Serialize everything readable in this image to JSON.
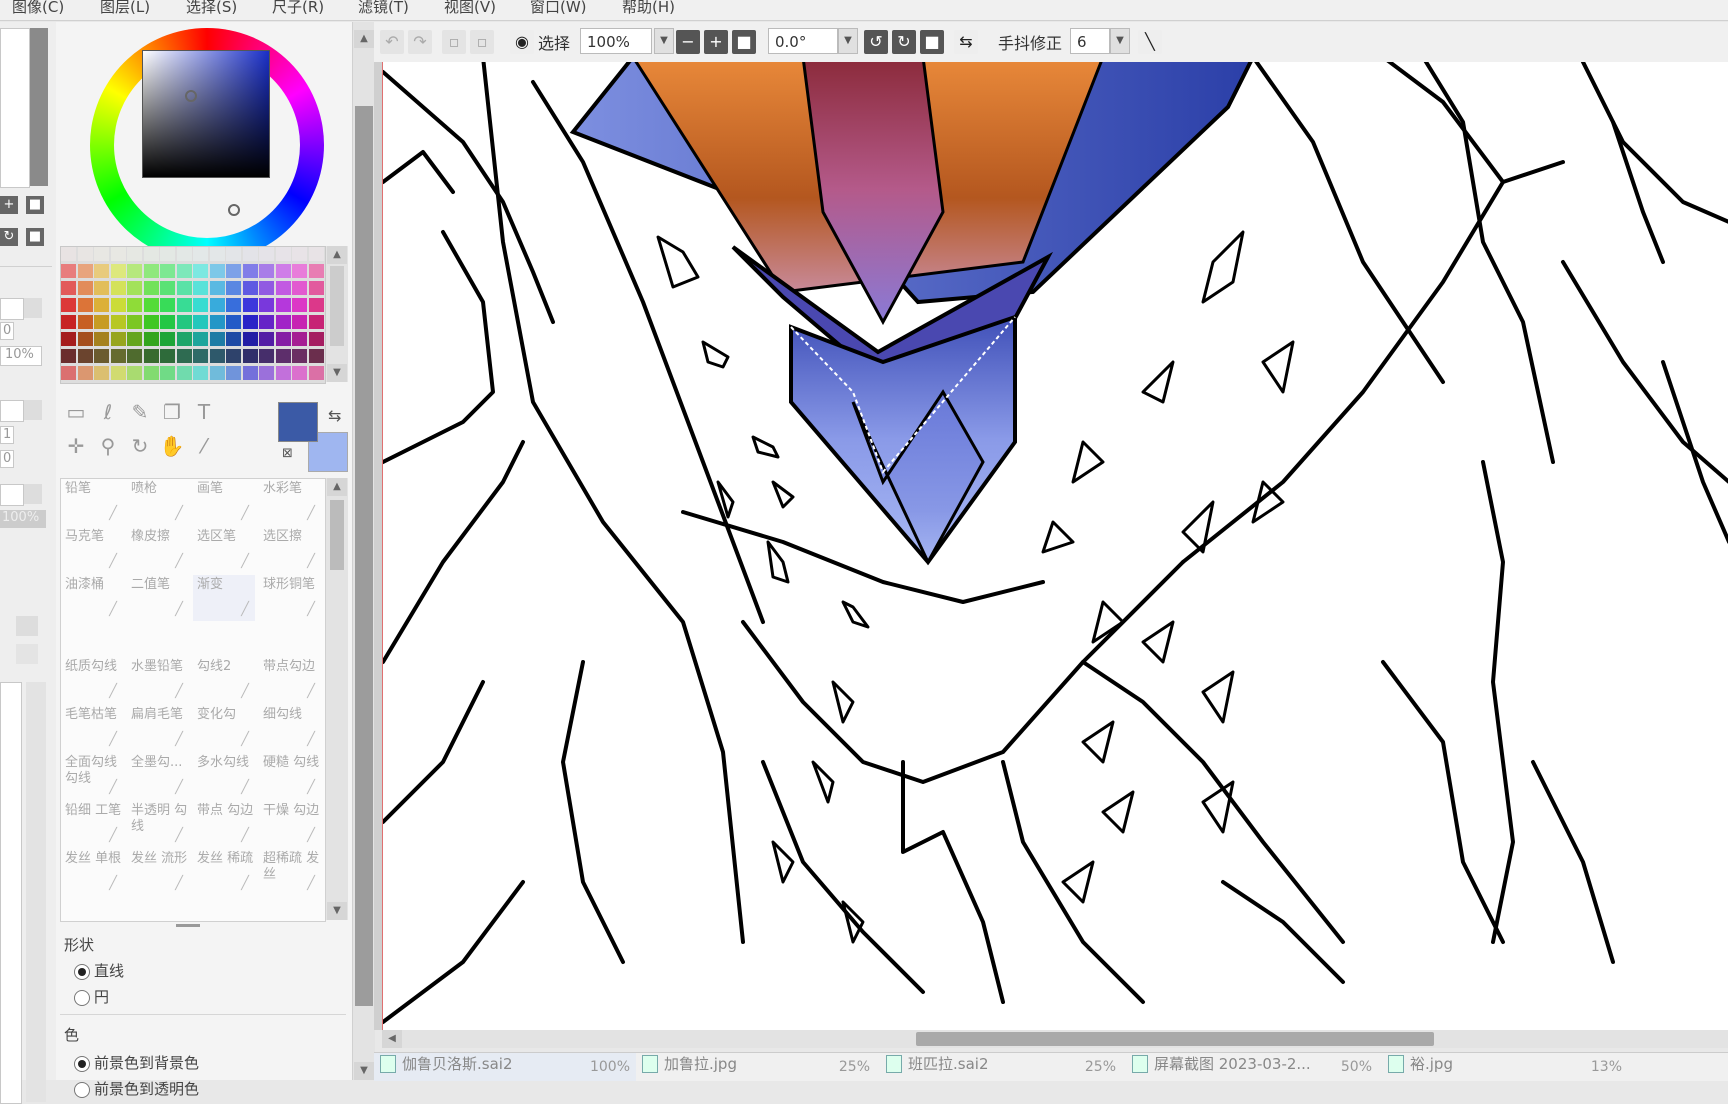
{
  "menu": [
    "图像(C)",
    "图层(L)",
    "选择(S)",
    "尺子(R)",
    "滤镜(T)",
    "视图(V)",
    "窗口(W)",
    "帮助(H)"
  ],
  "left_strip": {
    "values": [
      "0",
      "10%",
      "1",
      "0",
      "100%"
    ]
  },
  "tools": {
    "text_tool_glyph": "T",
    "foreground_color": "#3b5aa6",
    "background_color": "#9fb6f0"
  },
  "brushes": [
    {
      "label": "铅笔"
    },
    {
      "label": "喷枪"
    },
    {
      "label": "画笔"
    },
    {
      "label": "水彩笔"
    },
    {
      "label": "马克笔"
    },
    {
      "label": "橡皮擦"
    },
    {
      "label": "选区笔"
    },
    {
      "label": "选区擦"
    },
    {
      "label": "油漆桶"
    },
    {
      "label": "二值笔"
    },
    {
      "label": "渐变",
      "selected": true
    },
    {
      "label": "球形铜笔"
    },
    {
      "label": ""
    },
    {
      "label": ""
    },
    {
      "label": ""
    },
    {
      "label": ""
    },
    {
      "label": "纸质勾线"
    },
    {
      "label": "水墨铅笔"
    },
    {
      "label": "勾线2"
    },
    {
      "label": "带点勾边"
    },
    {
      "label": "毛笔枯笔"
    },
    {
      "label": "扁肩毛笔"
    },
    {
      "label": "变化勾"
    },
    {
      "label": "细勾线"
    },
    {
      "label": "全面勾线 勾线"
    },
    {
      "label": "全墨勾..."
    },
    {
      "label": "多水勾线"
    },
    {
      "label": "硬糙 勾线"
    },
    {
      "label": "铅细 工笔"
    },
    {
      "label": "半透明 勾线"
    },
    {
      "label": "带点 勾边"
    },
    {
      "label": "干燥 勾边"
    },
    {
      "label": "发丝 单根"
    },
    {
      "label": "发丝 流形"
    },
    {
      "label": "发丝 稀疏"
    },
    {
      "label": "超稀疏 发丝"
    }
  ],
  "shape_section": {
    "title": "形状",
    "options": [
      {
        "label": "直线",
        "checked": true
      },
      {
        "label": "円",
        "checked": false
      }
    ]
  },
  "color_section": {
    "title": "色",
    "options": [
      {
        "label": "前景色到背景色",
        "checked": true
      },
      {
        "label": "前景色到透明色",
        "checked": false
      }
    ]
  },
  "toolbar": {
    "select_label": "选择",
    "zoom_value": "100%",
    "rotation_value": "0.0°",
    "stabilizer_label": "手抖修正",
    "stabilizer_value": "6"
  },
  "document_tabs": [
    {
      "name": "伽鲁贝洛斯.sai2",
      "zoom": "100%",
      "active": true
    },
    {
      "name": "加鲁拉.jpg",
      "zoom": "25%",
      "active": false
    },
    {
      "name": "班匹拉.sai2",
      "zoom": "25%",
      "active": false
    },
    {
      "name": "屏幕截图 2023-03-2...",
      "zoom": "50%",
      "active": false
    },
    {
      "name": "裕.jpg",
      "zoom": "13%",
      "active": false
    }
  ]
}
